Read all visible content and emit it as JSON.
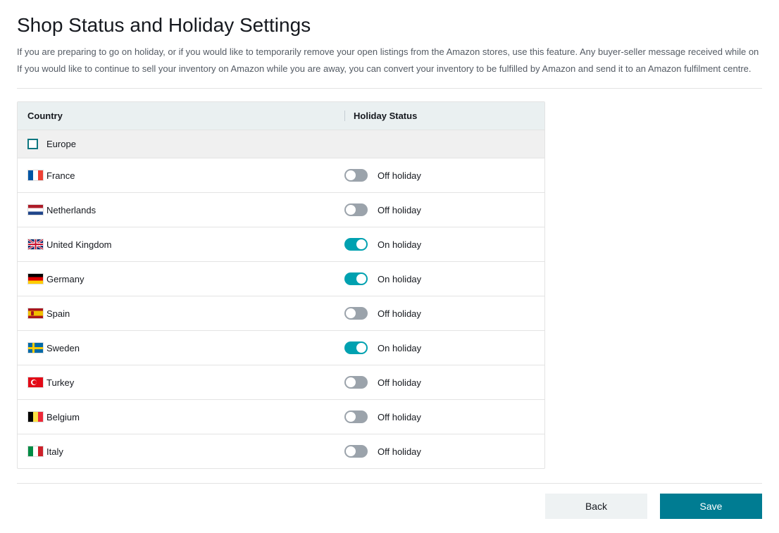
{
  "page": {
    "title": "Shop Status and Holiday Settings",
    "description_line1": "If you are preparing to go on holiday, or if you would like to temporarily remove your open listings from the Amazon stores, use this feature. Any buyer-seller message received while on",
    "description_line2": "If you would like to continue to sell your inventory on Amazon while you are away, you can convert your inventory to be fulfilled by Amazon and send it to an Amazon fulfilment centre."
  },
  "table": {
    "headers": {
      "country": "Country",
      "status": "Holiday Status"
    },
    "region": {
      "name": "Europe",
      "checked": false
    },
    "status_labels": {
      "on": "On holiday",
      "off": "Off holiday"
    },
    "countries": [
      {
        "name": "France",
        "flag": "fr",
        "on_holiday": false
      },
      {
        "name": "Netherlands",
        "flag": "nl",
        "on_holiday": false
      },
      {
        "name": "United Kingdom",
        "flag": "uk",
        "on_holiday": true
      },
      {
        "name": "Germany",
        "flag": "de",
        "on_holiday": true
      },
      {
        "name": "Spain",
        "flag": "es",
        "on_holiday": false
      },
      {
        "name": "Sweden",
        "flag": "se",
        "on_holiday": true
      },
      {
        "name": "Turkey",
        "flag": "tr",
        "on_holiday": false
      },
      {
        "name": "Belgium",
        "flag": "be",
        "on_holiday": false
      },
      {
        "name": "Italy",
        "flag": "it",
        "on_holiday": false
      }
    ]
  },
  "footer": {
    "back_label": "Back",
    "save_label": "Save"
  }
}
